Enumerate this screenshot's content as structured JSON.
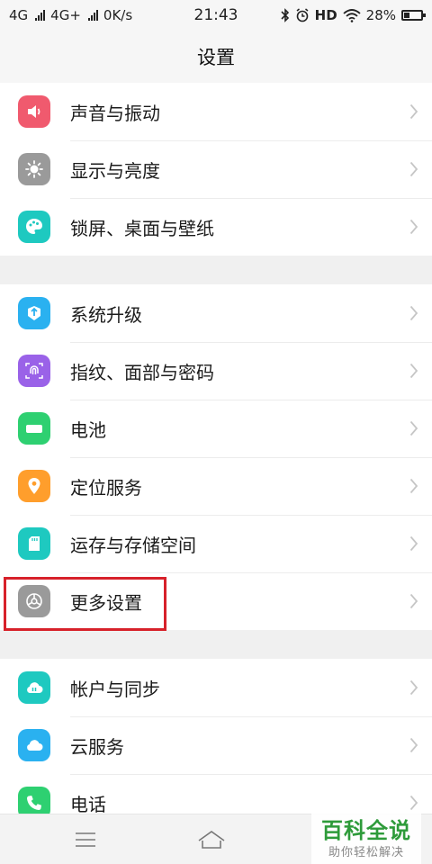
{
  "status_bar": {
    "network1": "4G",
    "network2": "4G+",
    "speed": "0K/s",
    "time": "21:43",
    "hd": "HD",
    "battery": "28%",
    "battery_level": 0.28
  },
  "header": {
    "title": "设置"
  },
  "groups": [
    {
      "items": [
        {
          "label": "声音与振动",
          "icon": "speaker-icon"
        },
        {
          "label": "显示与亮度",
          "icon": "brightness-icon"
        },
        {
          "label": "锁屏、桌面与壁纸",
          "icon": "palette-icon"
        }
      ]
    },
    {
      "items": [
        {
          "label": "系统升级",
          "icon": "system-update-icon"
        },
        {
          "label": "指纹、面部与密码",
          "icon": "fingerprint-icon"
        },
        {
          "label": "电池",
          "icon": "battery-icon"
        },
        {
          "label": "定位服务",
          "icon": "location-pin-icon"
        },
        {
          "label": "运存与存储空间",
          "icon": "sd-card-icon"
        },
        {
          "label": "更多设置",
          "icon": "gear-icon"
        }
      ]
    },
    {
      "items": [
        {
          "label": "帐户与同步",
          "icon": "cloud-sync-icon"
        },
        {
          "label": "云服务",
          "icon": "cloud-icon"
        },
        {
          "label": "电话",
          "icon": "phone-icon"
        }
      ]
    }
  ],
  "watermark": {
    "main": "百科全说",
    "sub": "助你轻松解决"
  },
  "colors": {
    "sound": "#f05a6e",
    "display": "#9a9a9a",
    "wallpaper": "#1ec9c0",
    "update": "#2ab1f0",
    "fingerprint": "#9a62e8",
    "battery": "#2ed071",
    "location": "#ff9e2c",
    "storage": "#1ec9c0",
    "more": "#9a9a9a",
    "account": "#1ec9c0",
    "cloud": "#2ab1f0",
    "phone": "#2ed071",
    "highlight": "#d7212a"
  }
}
